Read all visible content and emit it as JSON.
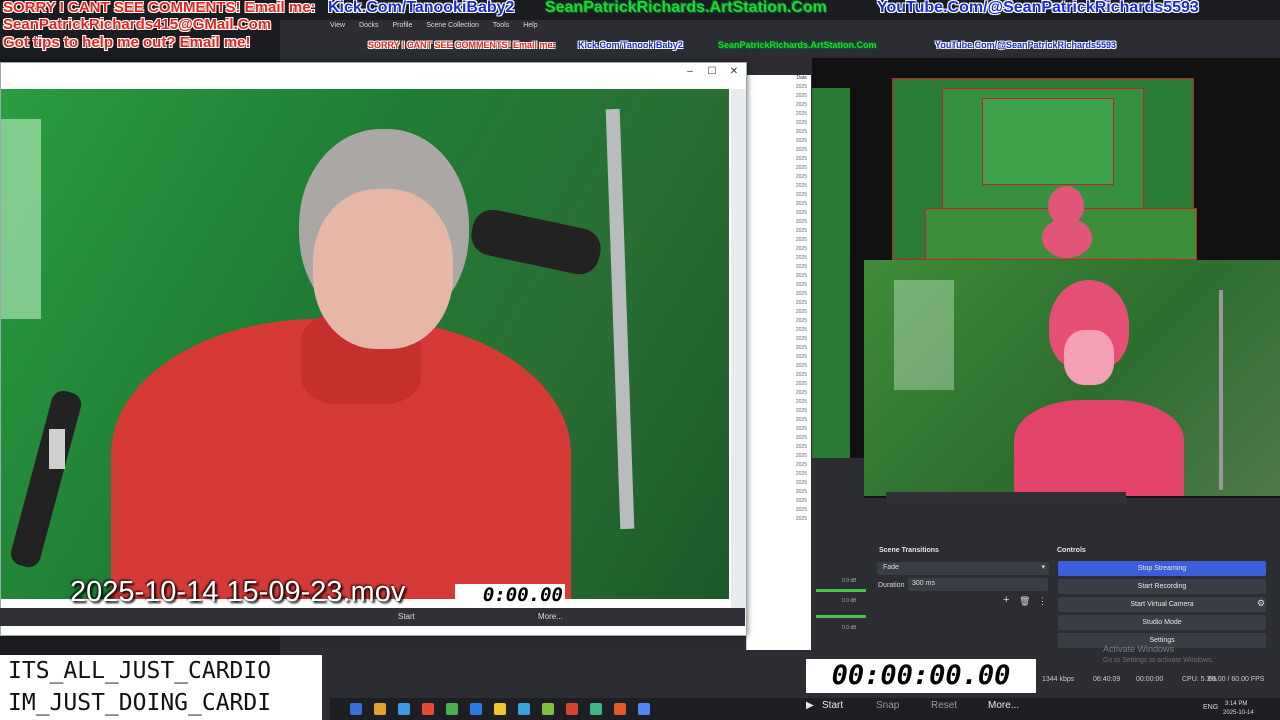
{
  "banner": {
    "line1_red": "SORRY I CANT SEE COMMENTS! Email me:",
    "line1_blue": "Kick.Com/TanookiBaby2",
    "line1_green": "SeanPatrickRichards.ArtStation.Com",
    "line1_blue2": "YouTube.Com/@SeanPatrickRichards5593",
    "line2": "SeanPatrickRichards415@GMail.Com",
    "line3": "Got tips to help me out? Email me!"
  },
  "obs_menu": [
    "View",
    "Docks",
    "Profile",
    "Scene Collection",
    "Tools",
    "Help"
  ],
  "nested_banner": {
    "red": "SORRY I CANT SEE COMMENTS! Email me:",
    "blue": "Kick.Com/TanookiBaby2",
    "green": "SeanPatrickRichards.ArtStation.Com",
    "blue2": "YouTube.Com/@SeanPatrickRichards5593"
  },
  "player": {
    "filename": "2025-10-14 15-09-23.mov",
    "timer": "0:00.00",
    "start_label": "Start",
    "more_label": "More..."
  },
  "file_list": {
    "header": "Date",
    "rows": [
      "2025",
      "2025",
      "2025",
      "2025",
      "2025",
      "2025",
      "2025",
      "2025",
      "2025",
      "2025",
      "2025",
      "2025",
      "2025",
      "2025",
      "2025",
      "2025",
      "2025",
      "2025",
      "2025",
      "2025",
      "2025",
      "2025",
      "2025",
      "2025",
      "2025",
      "2025",
      "2025",
      "2025",
      "2025",
      "2025",
      "2025",
      "2025",
      "2025",
      "2025",
      "2025",
      "2025",
      "2025",
      "2025",
      "2025",
      "2025",
      "2025",
      "2025",
      "2025",
      "2025",
      "2025",
      "2025",
      "2025",
      "2025",
      "2025"
    ]
  },
  "text_box": {
    "line1": "ITS_ALL_JUST_CARDIO",
    "line2": "IM_JUST_DOING_CARDI"
  },
  "scene_transitions": {
    "title": "Scene Transitions",
    "transition": "Fade",
    "duration_label": "Duration",
    "duration_value": "300 ms"
  },
  "controls": {
    "title": "Controls",
    "buttons": [
      "Stop Streaming",
      "Start Recording",
      "Start Virtual Camera",
      "Studio Mode",
      "Settings"
    ]
  },
  "big_timer": {
    "value": "00:00:00.00",
    "start": "Start",
    "snap": "Snap",
    "reset": "Reset",
    "more": "More..."
  },
  "status_bar": {
    "kbps": "1344 kbps",
    "time1": "06:40:09",
    "time2": "00:00:00",
    "cpu": "CPU: 5.3%",
    "fps": "60.00 / 60.00 FPS"
  },
  "tray": {
    "lang": "ENG",
    "time": "3:14 PM",
    "date": "2025-10-14"
  },
  "watermark": {
    "line1": "Activate Windows",
    "line2": "Go to Settings to activate Windows."
  },
  "mixer_db": [
    "0.0 dB",
    "0.0 dB",
    "0.0 dB"
  ],
  "colors": {
    "red": "#e8231f",
    "blue": "#1a2bd6",
    "green": "#27d62c",
    "accent": "#3a5fd9"
  }
}
